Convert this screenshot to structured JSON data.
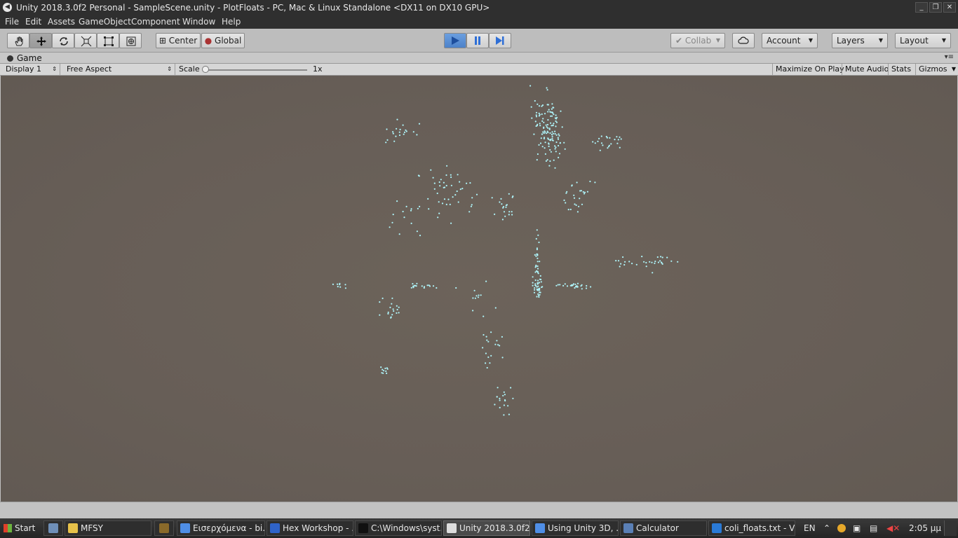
{
  "window": {
    "title": "Unity 2018.3.0f2 Personal - SampleScene.unity - PlotFloats - PC, Mac & Linux Standalone <DX11 on DX10 GPU>",
    "logo_icon": "unity-logo-icon"
  },
  "menu": [
    "File",
    "Edit",
    "Assets",
    "GameObject",
    "Component",
    "Window",
    "Help"
  ],
  "toolbar": {
    "tools": [
      "hand-tool-icon",
      "move-tool-icon",
      "rotate-tool-icon",
      "scale-tool-icon",
      "rect-tool-icon",
      "transform-tool-icon"
    ],
    "pivot_label": "Center",
    "space_label": "Global",
    "collab_label": "Collab",
    "account_label": "Account",
    "layers_label": "Layers",
    "layout_label": "Layout"
  },
  "game": {
    "tab_label": "Game",
    "display": "Display 1",
    "aspect": "Free Aspect",
    "scale_label": "Scale",
    "scale_value": "1x",
    "maximize_label": "Maximize On Play",
    "mute_label": "Mute Audio",
    "stats_label": "Stats",
    "gizmos_label": "Gizmos"
  },
  "plot": {
    "point_color": "#aef3f8"
  },
  "taskbar": {
    "start_label": "Start",
    "tasks": [
      {
        "label": "MFSY",
        "color": "#e7c24a"
      },
      {
        "label": "Εισερχόμενα - bi...",
        "color": "#4f8ee6"
      },
      {
        "label": "Hex Workshop - ...",
        "color": "#2f63c9"
      },
      {
        "label": "C:\\Windows\\syst...",
        "color": "#111111"
      },
      {
        "label": "Unity 2018.3.0f2 ...",
        "color": "#dddddd"
      },
      {
        "label": "Using Unity 3D, ...",
        "color": "#4f8ee6"
      },
      {
        "label": "Calculator",
        "color": "#5a7fb5"
      },
      {
        "label": "coli_floats.txt - V...",
        "color": "#2a7ad6"
      }
    ],
    "lang": "EN",
    "time": "2:05 μμ"
  }
}
